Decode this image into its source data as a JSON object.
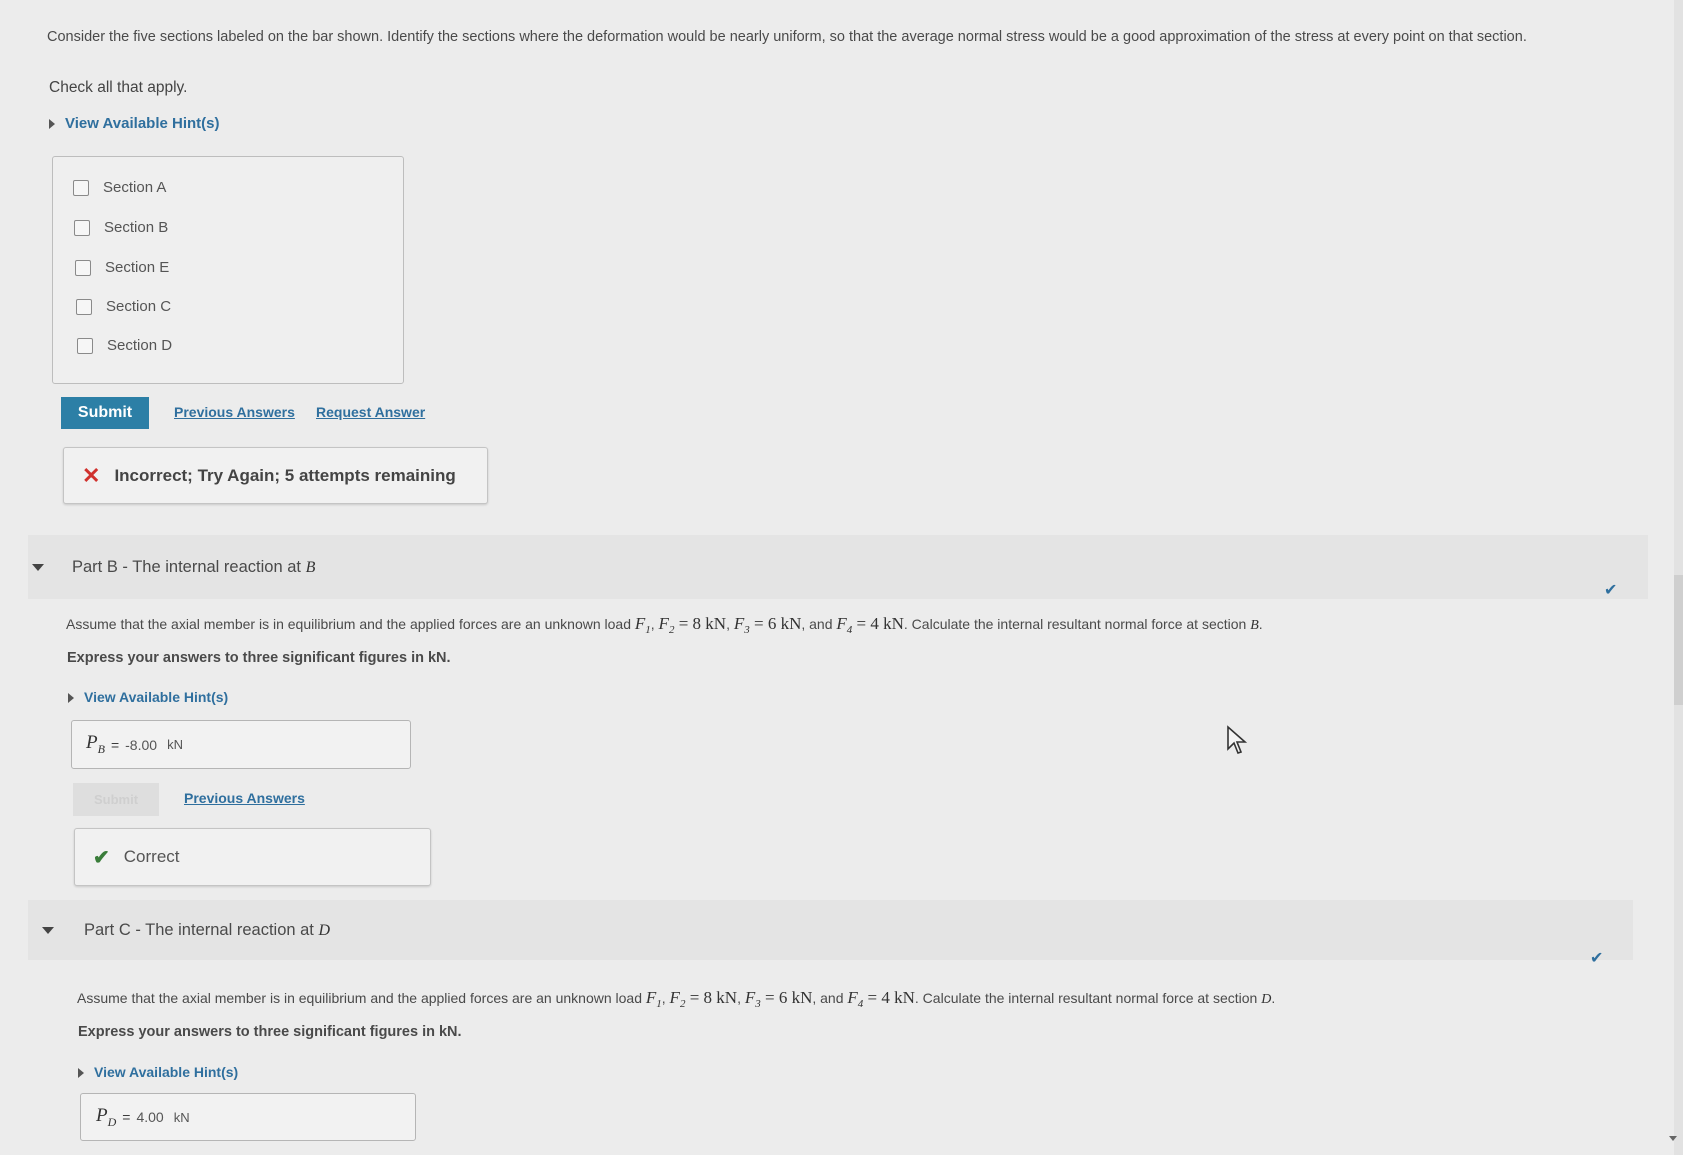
{
  "part_a": {
    "intro": "Consider the five sections labeled on the bar shown. Identify the sections where the deformation would be nearly uniform, so that the average normal stress would be a good approximation of the stress at every point on that section.",
    "instruction": "Check all that apply.",
    "hint_link": "View Available Hint(s)",
    "options": [
      "Section A",
      "Section B",
      "Section E",
      "Section C",
      "Section D"
    ],
    "submit_label": "Submit",
    "previous_answers": "Previous Answers",
    "request_answer": "Request Answer",
    "feedback": "Incorrect; Try Again; 5 attempts remaining"
  },
  "part_b": {
    "header": "Part B - The internal reaction at ",
    "header_var": "B",
    "q_lead": "Assume that the axial member is in equilibrium and the applied forces are an unknown load ",
    "q_f1": "F",
    "q_f1_sub": "1",
    "q_f2": "F",
    "q_f2_sub": "2",
    "q_f2_val": " = 8 kN",
    "q_f3": "F",
    "q_f3_sub": "3",
    "q_f3_val": " = 6 kN",
    "q_and": ", and ",
    "q_f4": "F",
    "q_f4_sub": "4",
    "q_f4_val": " = 4 kN",
    "q_tail": ". Calculate the internal resultant normal force at section ",
    "q_section": "B",
    "express": "Express your answers to three significant figures in kN.",
    "hint_link": "View Available Hint(s)",
    "answer_var": "P",
    "answer_sub": "B",
    "answer_eq": "=",
    "answer_value": "-8.00",
    "answer_unit": "kN",
    "submit_label": "Submit",
    "previous_answers": "Previous Answers",
    "feedback": "Correct"
  },
  "part_c": {
    "header": "Part C - The internal reaction at ",
    "header_var": "D",
    "q_lead": "Assume that the axial member is in equilibrium and the applied forces are an unknown load ",
    "q_f1": "F",
    "q_f1_sub": "1",
    "q_f2": "F",
    "q_f2_sub": "2",
    "q_f2_val": " = 8 kN",
    "q_f3": "F",
    "q_f3_sub": "3",
    "q_f3_val": " = 6 kN",
    "q_and": ", and ",
    "q_f4": "F",
    "q_f4_sub": "4",
    "q_f4_val": " = 4 kN",
    "q_tail": ". Calculate the internal resultant normal force at section ",
    "q_section": "D",
    "express": "Express your answers to three significant figures in kN.",
    "hint_link": "View Available Hint(s)",
    "answer_var": "P",
    "answer_sub": "D",
    "answer_eq": "=",
    "answer_value": "4.00",
    "answer_unit": "kN"
  },
  "colors": {
    "accent": "#2c7fa6",
    "link": "#2f6f9e",
    "error": "#d0312d",
    "success": "#3a7d3a"
  }
}
